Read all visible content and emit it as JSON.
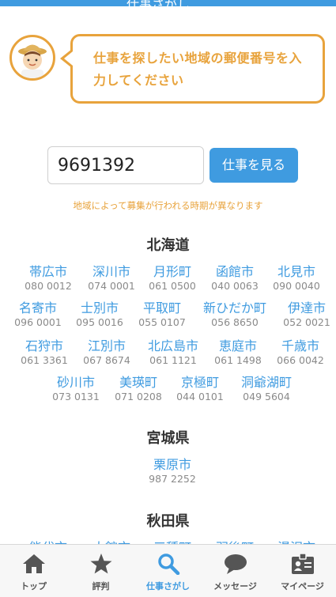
{
  "header": {
    "title": "仕事さがし",
    "right": ""
  },
  "prompt": {
    "message": "仕事を探したい地域の郵便番号を入力してください"
  },
  "search": {
    "zip_value": "9691392",
    "button_label": "仕事を見る"
  },
  "notice": "地域によって募集が行われる時期が異なります",
  "regions": [
    {
      "name": "北海道",
      "cities": [
        {
          "name": "帯広市",
          "zip": "080 0012"
        },
        {
          "name": "深川市",
          "zip": "074 0001"
        },
        {
          "name": "月形町",
          "zip": "061 0500"
        },
        {
          "name": "函館市",
          "zip": "040 0063"
        },
        {
          "name": "北見市",
          "zip": "090 0040"
        },
        {
          "name": "名寄市",
          "zip": "096 0001"
        },
        {
          "name": "士別市",
          "zip": "095 0016"
        },
        {
          "name": "平取町",
          "zip": "055 0107"
        },
        {
          "name": "新ひだか町",
          "zip": "056 8650"
        },
        {
          "name": "伊達市",
          "zip": "052 0021"
        },
        {
          "name": "石狩市",
          "zip": "061 3361"
        },
        {
          "name": "江別市",
          "zip": "067 8674"
        },
        {
          "name": "北広島市",
          "zip": "061 1121"
        },
        {
          "name": "恵庭市",
          "zip": "061 1498"
        },
        {
          "name": "千歳市",
          "zip": "066 0042"
        },
        {
          "name": "砂川市",
          "zip": "073 0131"
        },
        {
          "name": "美瑛町",
          "zip": "071 0208"
        },
        {
          "name": "京極町",
          "zip": "044 0101"
        },
        {
          "name": "洞爺湖町",
          "zip": "049 5604"
        }
      ]
    },
    {
      "name": "宮城県",
      "cities": [
        {
          "name": "栗原市",
          "zip": "987 2252"
        }
      ]
    },
    {
      "name": "秋田県",
      "cities": [
        {
          "name": "能代市",
          "zip": ""
        },
        {
          "name": "大館市",
          "zip": ""
        },
        {
          "name": "三種町",
          "zip": ""
        },
        {
          "name": "羽後町",
          "zip": ""
        },
        {
          "name": "湯沢市",
          "zip": ""
        }
      ]
    }
  ],
  "tabs": [
    {
      "label": "トップ",
      "icon": "home-icon"
    },
    {
      "label": "評判",
      "icon": "star-icon"
    },
    {
      "label": "仕事さがし",
      "icon": "search-icon",
      "active": true
    },
    {
      "label": "メッセージ",
      "icon": "chat-icon"
    },
    {
      "label": "マイページ",
      "icon": "profile-card-icon"
    }
  ],
  "colors": {
    "accent": "#3f9be0",
    "orange": "#e8a33c"
  }
}
